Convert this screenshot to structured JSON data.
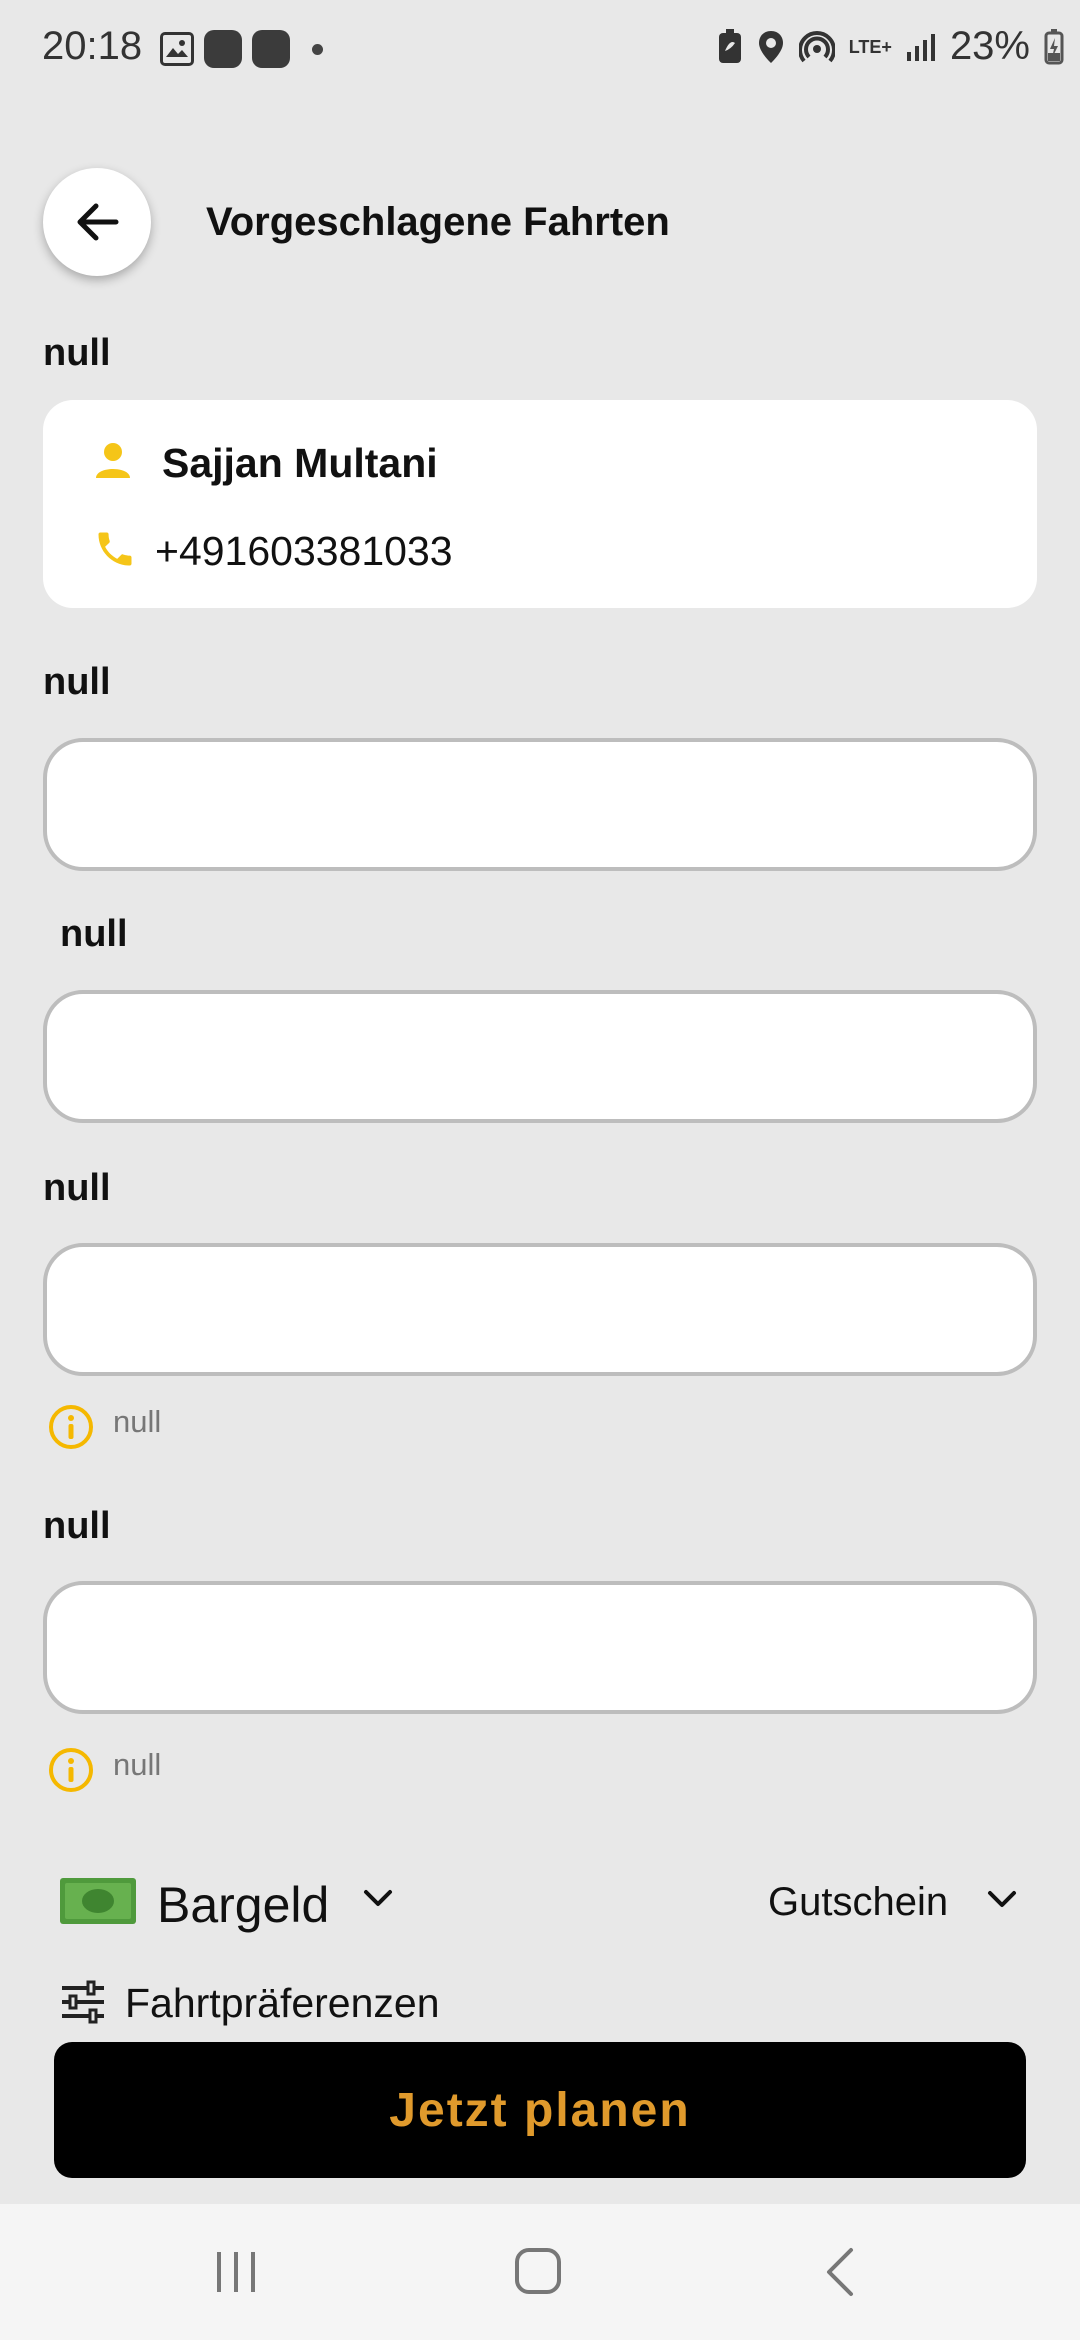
{
  "status_bar": {
    "time": "20:18",
    "network": "LTE+",
    "battery": "23%"
  },
  "header": {
    "title": "Vorgeschlagene Fahrten",
    "back_icon": "arrow-left-icon"
  },
  "contact": {
    "section_label": "null",
    "name": "Sajjan Multani",
    "phone": "+491603381033",
    "accent_color": "#f5c518"
  },
  "fields": [
    {
      "label": "null",
      "value": ""
    },
    {
      "label": "null",
      "value": ""
    },
    {
      "label": "null",
      "value": "",
      "hint": "null"
    },
    {
      "label": "null",
      "value": "",
      "hint": "null"
    }
  ],
  "payment": {
    "method": "Bargeld",
    "voucher": "Gutschein",
    "preferences": "Fahrtpräferenzen"
  },
  "actions": {
    "plan_label": "Jetzt planen",
    "plan_text_color": "#e09a2c"
  }
}
